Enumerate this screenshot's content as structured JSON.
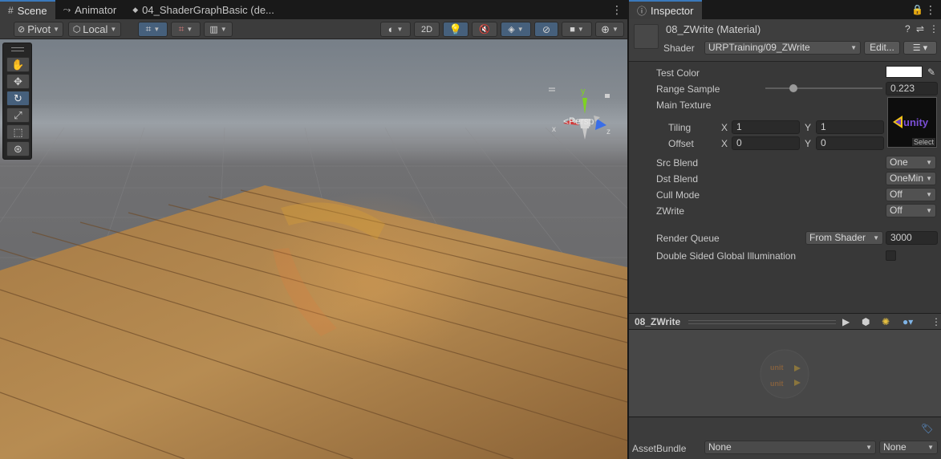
{
  "scene": {
    "tabs": [
      {
        "label": "Scene",
        "icon": "grid-icon"
      },
      {
        "label": "Animator",
        "icon": "animator-icon"
      },
      {
        "label": "04_ShaderGraphBasic (de...",
        "icon": "shadergraph-icon"
      }
    ],
    "toolbar": {
      "pivot_label": "Pivot",
      "local_label": "Local",
      "mode_2d_label": "2D"
    },
    "gizmo": {
      "x_label": "x",
      "y_label": "y",
      "z_label": "z",
      "projection_label": "Persp"
    }
  },
  "inspector": {
    "tab_label": "Inspector",
    "material_title": "08_ZWrite (Material)",
    "shader_label": "Shader",
    "shader_value": "URPTraining/09_ZWrite",
    "edit_label": "Edit...",
    "properties": {
      "test_color_label": "Test Color",
      "test_color_value": "#ffffff",
      "range_sample_label": "Range Sample",
      "range_sample_value": "0.223",
      "main_texture_label": "Main Texture",
      "tiling_label": "Tiling",
      "tiling_x": "1",
      "tiling_y": "1",
      "offset_label": "Offset",
      "offset_x": "0",
      "offset_y": "0",
      "x_label": "X",
      "y_label": "Y",
      "texture_select_label": "Select",
      "texture_logo_text": "unity",
      "src_blend_label": "Src Blend",
      "src_blend_value": "One",
      "dst_blend_label": "Dst Blend",
      "dst_blend_value": "OneMin",
      "cull_mode_label": "Cull Mode",
      "cull_mode_value": "Off",
      "zwrite_label": "ZWrite",
      "zwrite_value": "Off",
      "render_queue_label": "Render Queue",
      "render_queue_mode": "From Shader",
      "render_queue_value": "3000",
      "double_sided_gi_label": "Double Sided Global Illumination"
    },
    "preview_title": "08_ZWrite",
    "asset_bundle_label": "AssetBundle",
    "asset_bundle_name": "None",
    "asset_bundle_variant": "None"
  },
  "colors": {
    "accent": "#3a79bb",
    "active_tool": "#46607c",
    "axis_x": "#d23a3a",
    "axis_y": "#7ed321",
    "axis_z": "#3a6ee8"
  }
}
